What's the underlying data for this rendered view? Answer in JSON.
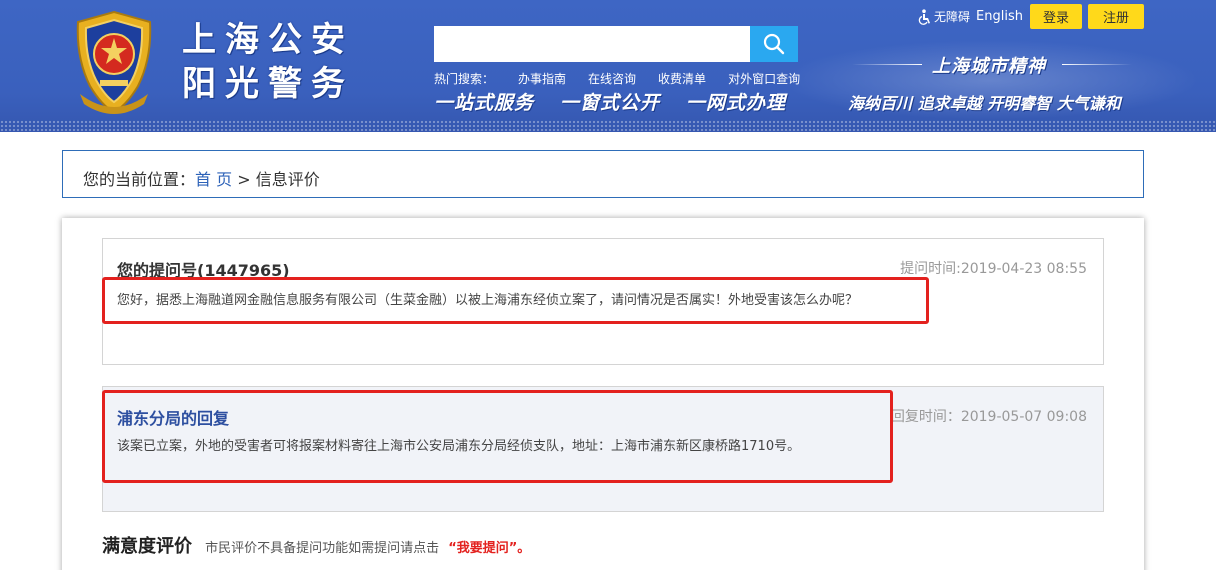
{
  "header": {
    "site_title_line1": "上海公安",
    "site_title_line2": "阳光警务",
    "search": {
      "placeholder": "",
      "value": ""
    },
    "hot_search": {
      "label": "热门搜索：",
      "items": [
        "办事指南",
        "在线咨询",
        "收费清单",
        "对外窗口查询"
      ]
    },
    "slogans": [
      "一站式服务",
      "一窗式公开",
      "一网式办理"
    ],
    "top_links": {
      "accessibility": "无障碍",
      "english": "English"
    },
    "login_label": "登录",
    "register_label": "注册",
    "spirit_title": "上海城市精神",
    "spirit_text": "海纳百川 追求卓越 开明睿智 大气谦和"
  },
  "breadcrumb": {
    "prefix": "您的当前位置：",
    "home": "首 页",
    "separator": ">",
    "current": "信息评价"
  },
  "question": {
    "title": "您的提问号(1447965)",
    "time": "提问时间:2019-04-23 08:55",
    "body": "您好，据悉上海融道网金融信息服务有限公司（生菜金融）以被上海浦东经侦立案了，请问情况是否属实！外地受害该怎么办呢？"
  },
  "reply": {
    "title": "浦东分局的回复",
    "time": "回复时间：2019-05-07 09:08",
    "body": "该案已立案，外地的受害者可将报案材料寄往上海市公安局浦东分局经侦支队，地址：上海市浦东新区康桥路1710号。"
  },
  "rating": {
    "title": "满意度评价",
    "note": "市民评价不具备提问功能如需提问请点击",
    "link": "“我要提问”。"
  },
  "colors": {
    "header_blue": "#3e66c4",
    "search_button": "#2aa8f0",
    "yellow_button": "#ffd91a",
    "highlight_red": "#e3211e",
    "link_blue": "#2d62b8"
  }
}
